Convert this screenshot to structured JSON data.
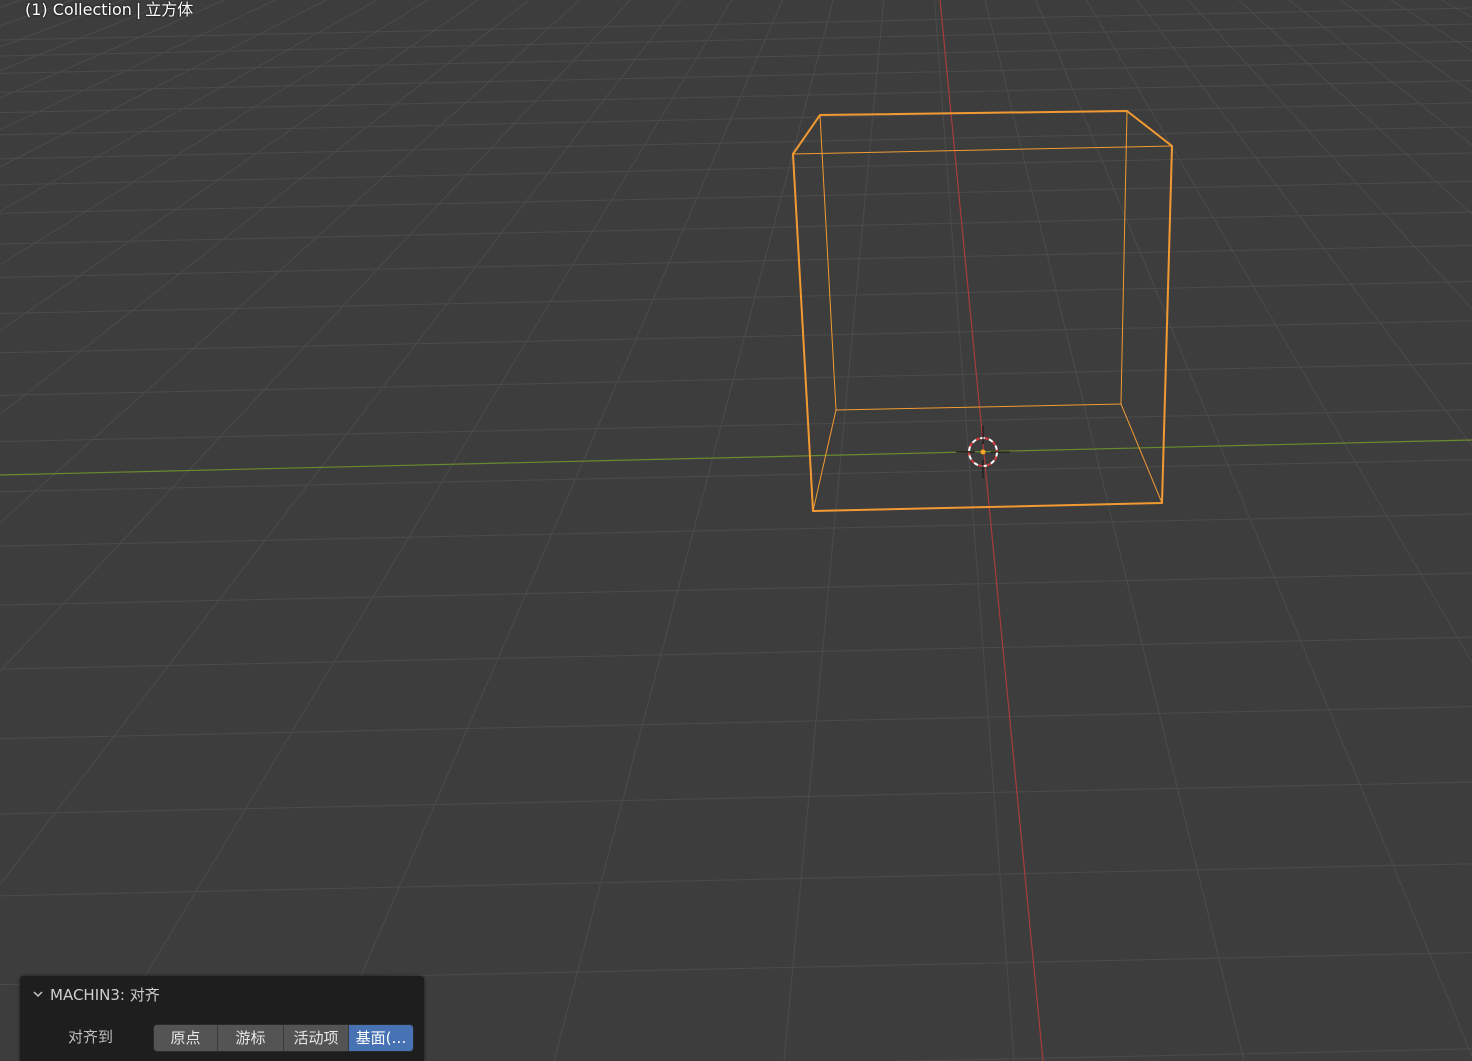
{
  "viewport": {
    "header_collection": "(1) Collection",
    "header_separator": "|",
    "header_object": "立方体",
    "colors": {
      "background": "#3d3d3d",
      "grid": "#4a4a4a",
      "x_axis": "#a83a3a",
      "y_axis": "#6a8a2c",
      "selection": "#f29a32"
    }
  },
  "operator_panel": {
    "title": "MACHIN3: 对齐",
    "expanded_icon": "chevron-down-icon",
    "align_to_label": "对齐到",
    "options": [
      {
        "label": "原点",
        "active": false
      },
      {
        "label": "游标",
        "active": false
      },
      {
        "label": "活动项",
        "active": false
      },
      {
        "label": "基面(…",
        "active": true
      }
    ]
  }
}
